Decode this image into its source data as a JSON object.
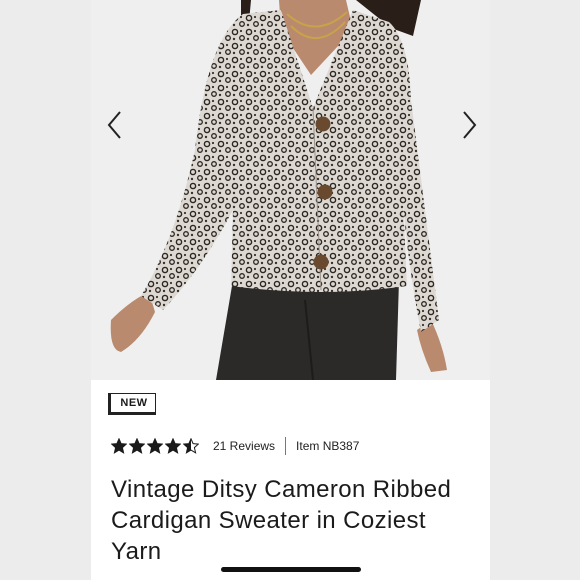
{
  "product": {
    "badge": "NEW",
    "rating": 4.5,
    "reviews_label": "21 Reviews",
    "item_number": "Item NB387",
    "title": "Vintage Ditsy Cameron Ribbed Cardigan Sweater in Coziest Yarn"
  },
  "gallery": {
    "prev_icon": "chevron-left-icon",
    "next_icon": "chevron-right-icon"
  },
  "colors": {
    "star": "#1a1a1a",
    "accent": "#1b1b1b"
  }
}
